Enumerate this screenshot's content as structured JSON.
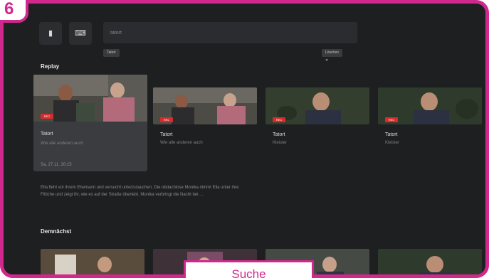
{
  "step_badge": "6",
  "topbar": {
    "btn1_icon": "tile-icon",
    "btn2_icon": "keyboard-icon",
    "search_placeholder": "tatort",
    "chip_left": "Tatort",
    "chip_right": "Löschen ✕"
  },
  "sections": {
    "replay": "Replay",
    "upcoming": "Demnächst"
  },
  "replay_cards": [
    {
      "title": "Tatort",
      "subtitle": "Wie alle anderen auch",
      "date": "Sa, 27.11. 20:15",
      "focused": true
    },
    {
      "title": "Tatort",
      "subtitle": "Wie alle anderen auch",
      "date": "",
      "focused": false
    },
    {
      "title": "Tatort",
      "subtitle": "Kleister",
      "date": "",
      "focused": false
    },
    {
      "title": "Tatort",
      "subtitle": "Kleister",
      "date": "",
      "focused": false
    }
  ],
  "description": "Ella fleht vor ihrem Ehemann und versucht unterzutauchen. Die obdachlose Monika nimmt Ella unter ihre Fittiche und zeigt ihr, wie es auf der Straße überlebt. Monika verbringt die Nacht bei ...",
  "live_badge": "REC",
  "callout": "Suche",
  "colors": {
    "accent": "#d1288e",
    "background": "#1e1f21",
    "live": "#d72c2c"
  }
}
